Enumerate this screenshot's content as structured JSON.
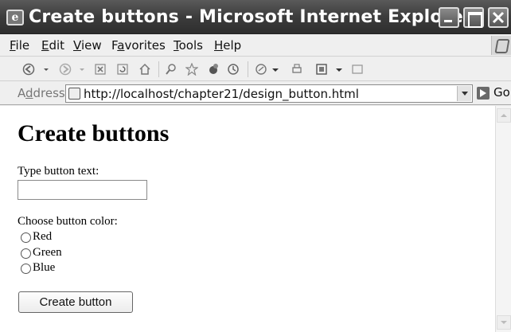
{
  "window": {
    "title": "Create buttons - Microsoft Internet Explorer"
  },
  "menu": {
    "items": [
      {
        "accel": "F",
        "rest": "ile"
      },
      {
        "accel": "E",
        "rest": "dit"
      },
      {
        "accel": "V",
        "rest": "iew"
      },
      {
        "pre": "F",
        "accel": "a",
        "rest": "vorites"
      },
      {
        "accel": "T",
        "rest": "ools"
      },
      {
        "accel": "H",
        "rest": "elp"
      }
    ]
  },
  "toolbar": {
    "icons": [
      "back-icon",
      "back-dropdown-icon",
      "forward-icon",
      "forward-dropdown-icon",
      "stop-icon",
      "refresh-icon",
      "home-icon",
      "search-icon",
      "favorites-icon",
      "media-icon",
      "history-icon",
      "mail-icon",
      "mail-dropdown-icon",
      "print-icon",
      "edit-icon",
      "edit-dropdown-icon",
      "discuss-icon"
    ]
  },
  "address": {
    "label_pre": "A",
    "label_accel": "d",
    "label_rest": "dress",
    "url": "http://localhost/chapter21/design_button.html",
    "go_label": "Go"
  },
  "page": {
    "heading": "Create buttons",
    "text_label": "Type button text:",
    "text_value": "",
    "color_label": "Choose button color:",
    "colors": [
      "Red",
      "Green",
      "Blue"
    ],
    "create_button": "Create button"
  }
}
